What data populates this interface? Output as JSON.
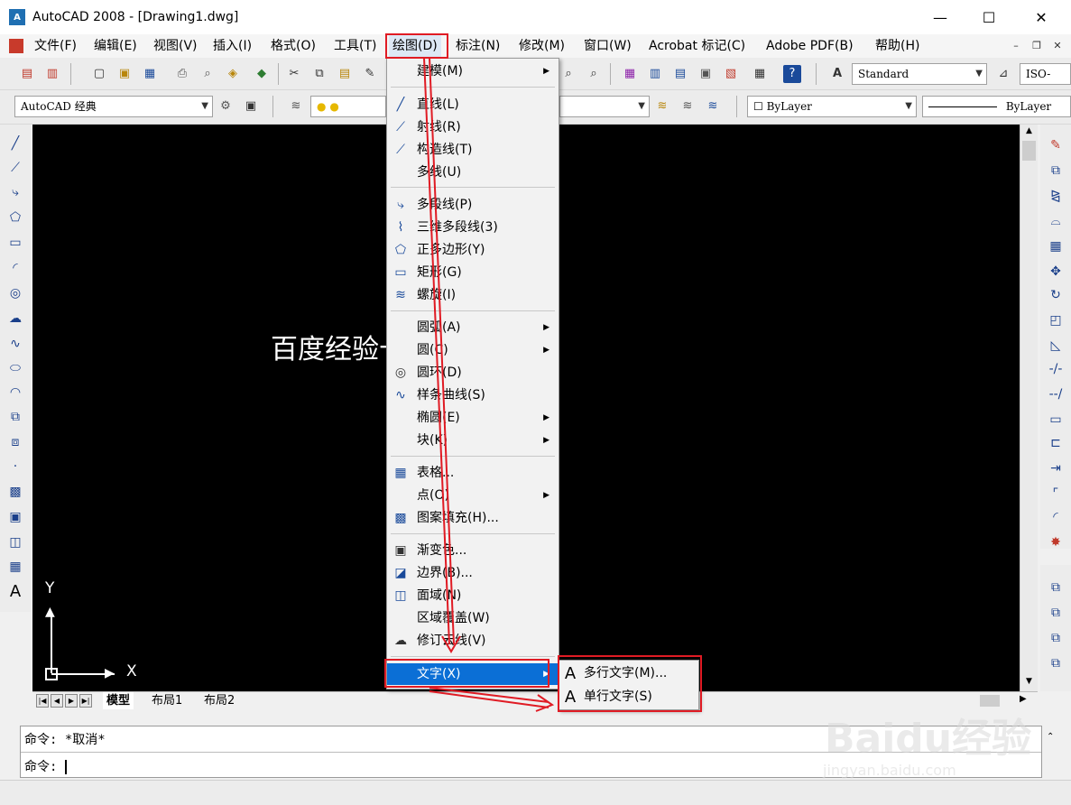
{
  "window": {
    "icon_text": "A",
    "title": "AutoCAD 2008 - [Drawing1.dwg]",
    "minimize": "—",
    "maximize": "☐",
    "close": "✕"
  },
  "menubar": {
    "items": [
      {
        "label": "文件(F)"
      },
      {
        "label": "编辑(E)"
      },
      {
        "label": "视图(V)"
      },
      {
        "label": "插入(I)"
      },
      {
        "label": "格式(O)"
      },
      {
        "label": "工具(T)"
      },
      {
        "label": "绘图(D)"
      },
      {
        "label": "标注(N)"
      },
      {
        "label": "修改(M)"
      },
      {
        "label": "窗口(W)"
      },
      {
        "label": "Acrobat 标记(C)"
      },
      {
        "label": "Adobe PDF(B)"
      },
      {
        "label": "帮助(H)"
      }
    ],
    "active": "绘图(D)"
  },
  "toolbar2": {
    "workspace": "AutoCAD 经典",
    "textstyle": "Standard",
    "dimstyle": "ISO-",
    "color": "ByLayer",
    "linetype": "ByLayer"
  },
  "draw_menu": {
    "items": [
      {
        "label": "建模(M)",
        "submenu": true,
        "icon": ""
      },
      {
        "label": "直线(L)",
        "icon": "line-icon"
      },
      {
        "label": "射线(R)",
        "icon": "ray-icon"
      },
      {
        "label": "构造线(T)",
        "icon": "xline-icon"
      },
      {
        "label": "多线(U)",
        "icon": ""
      },
      {
        "label": "多段线(P)",
        "icon": "polyline-icon"
      },
      {
        "label": "三维多段线(3)",
        "icon": "3d-polyline-icon"
      },
      {
        "label": "正多边形(Y)",
        "icon": "polygon-icon"
      },
      {
        "label": "矩形(G)",
        "icon": "rectangle-icon"
      },
      {
        "label": "螺旋(I)",
        "icon": "helix-icon"
      },
      {
        "label": "圆弧(A)",
        "submenu": true,
        "icon": ""
      },
      {
        "label": "圆(C)",
        "submenu": true,
        "icon": ""
      },
      {
        "label": "圆环(D)",
        "icon": "donut-icon"
      },
      {
        "label": "样条曲线(S)",
        "icon": "spline-icon"
      },
      {
        "label": "椭圆(E)",
        "submenu": true,
        "icon": ""
      },
      {
        "label": "块(K)",
        "submenu": true,
        "icon": ""
      },
      {
        "label": "表格...",
        "icon": "table-icon"
      },
      {
        "label": "点(O)",
        "submenu": true,
        "icon": ""
      },
      {
        "label": "图案填充(H)...",
        "icon": "hatch-icon"
      },
      {
        "label": "渐变色...",
        "icon": "gradient-icon"
      },
      {
        "label": "边界(B)...",
        "icon": "boundary-icon"
      },
      {
        "label": "面域(N)",
        "icon": "region-icon"
      },
      {
        "label": "区域覆盖(W)",
        "icon": ""
      },
      {
        "label": "修订云线(V)",
        "icon": "revcloud-icon"
      },
      {
        "label": "文字(X)",
        "submenu": true,
        "icon": "",
        "highlighted": true
      }
    ]
  },
  "text_submenu": {
    "items": [
      {
        "label": "多行文字(M)...",
        "icon": "mtext-icon",
        "glyph": "A"
      },
      {
        "label": "单行文字(S)",
        "icon": "dtext-icon",
        "glyph": "A"
      }
    ]
  },
  "canvas": {
    "text": "百度经验十一",
    "ucs_y": "Y",
    "ucs_x": "X"
  },
  "layout_tabs": [
    {
      "label": "模型"
    },
    {
      "label": "布局1"
    },
    {
      "label": "布局2"
    }
  ],
  "command": {
    "line1": "命令: *取消*",
    "line2": "命令: "
  },
  "watermark": {
    "line1": "Baidu经验",
    "line2": "jingyan.baidu.com"
  },
  "colors": {
    "highlight": "#0b6fd6",
    "annotation": "#e01b24",
    "canvas": "#000000"
  }
}
